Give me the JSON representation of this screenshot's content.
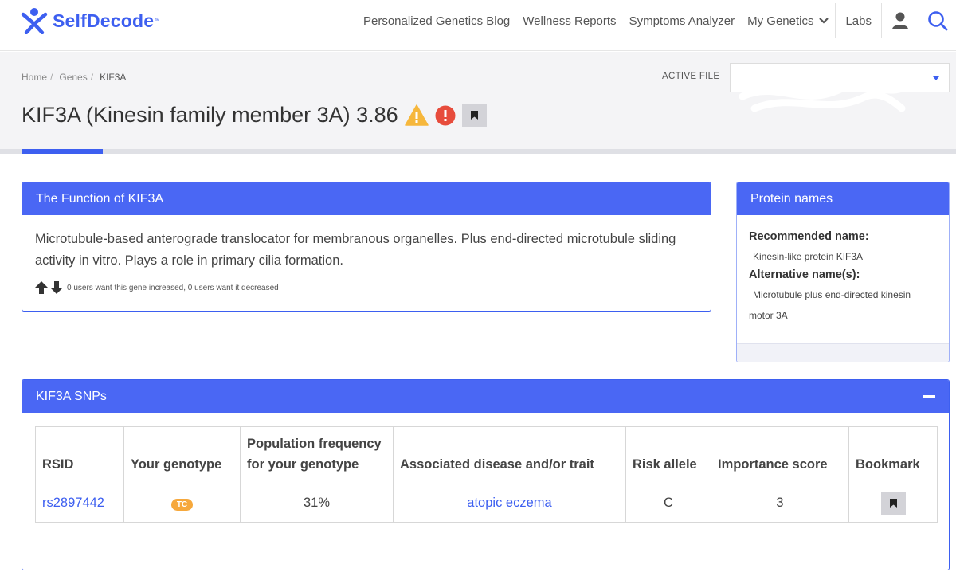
{
  "brand": {
    "name": "SelfDecode",
    "color": "#3d5ff0"
  },
  "nav": {
    "links": [
      "Personalized Genetics Blog",
      "Wellness Reports",
      "Symptoms Analyzer",
      "My Genetics",
      "Labs"
    ],
    "icons": [
      "user-icon",
      "search-icon"
    ]
  },
  "breadcrumb": [
    "Home",
    "Genes",
    "KIF3A"
  ],
  "active_file": {
    "label": "ACTIVE FILE",
    "value": ""
  },
  "page": {
    "title": "KIF3A (Kinesin family member 3A) 3.86",
    "icons": [
      "warning-icon",
      "alert-icon",
      "bookmark-icon"
    ]
  },
  "function_card": {
    "title": "The Function of KIF3A",
    "text": "Microtubule-based anterograde translocator for membranous organelles. Plus end-directed microtubule sliding activity in vitro. Plays a role in primary cilia formation.",
    "votes": "0 users want this gene increased, 0 users want it decreased"
  },
  "protein_card": {
    "title": "Protein names",
    "recommended_label": "Recommended name:",
    "recommended_value": "Kinesin-like protein KIF3A",
    "alternative_label": "Alternative name(s):",
    "alternative_value": "Microtubule plus end-directed kinesin motor 3A"
  },
  "snp_card": {
    "title": "KIF3A SNPs",
    "columns": [
      "RSID",
      "Your genotype",
      "Population frequency for your genotype",
      "Associated disease and/or trait",
      "Risk allele",
      "Importance score",
      "Bookmark"
    ],
    "rows": [
      {
        "rsid": "rs2897442",
        "genotype": "TC",
        "frequency": "31%",
        "trait": "atopic eczema",
        "risk_allele": "C",
        "importance": "3"
      }
    ]
  },
  "colors": {
    "accent": "#3d5ff0",
    "card_header": "#4a67f4",
    "warning": "#f6b73c",
    "alert": "#e74c3c",
    "genotype_badge": "#f6a83c"
  }
}
